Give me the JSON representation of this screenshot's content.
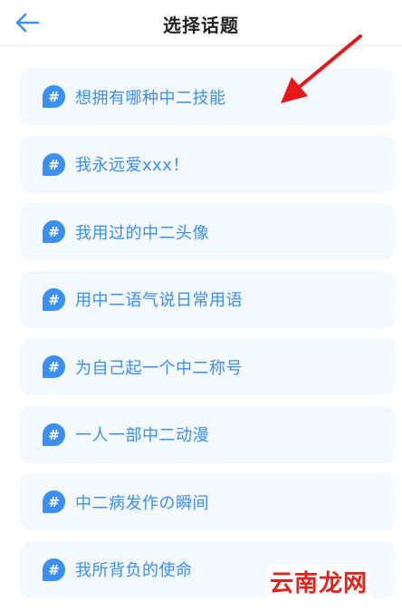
{
  "header": {
    "title": "选择话题"
  },
  "topics": [
    {
      "label": "想拥有哪种中二技能"
    },
    {
      "label": "我永远爱xxx！"
    },
    {
      "label": "我用过的中二头像"
    },
    {
      "label": "用中二语气说日常用语"
    },
    {
      "label": "为自己起一个中二称号"
    },
    {
      "label": "一人一部中二动漫"
    },
    {
      "label": "中二病发作の瞬间"
    },
    {
      "label": "我所背负的使命"
    }
  ],
  "watermark": {
    "text": "云南龙网"
  },
  "icons": {
    "back": "arrow-left-icon",
    "topic": "hashtag-bubble-icon",
    "annotation": "red-arrow-icon"
  },
  "colors": {
    "accent": "#3a8ff0",
    "item_bg": "#f4f8ff",
    "annotation": "#e8181a"
  }
}
